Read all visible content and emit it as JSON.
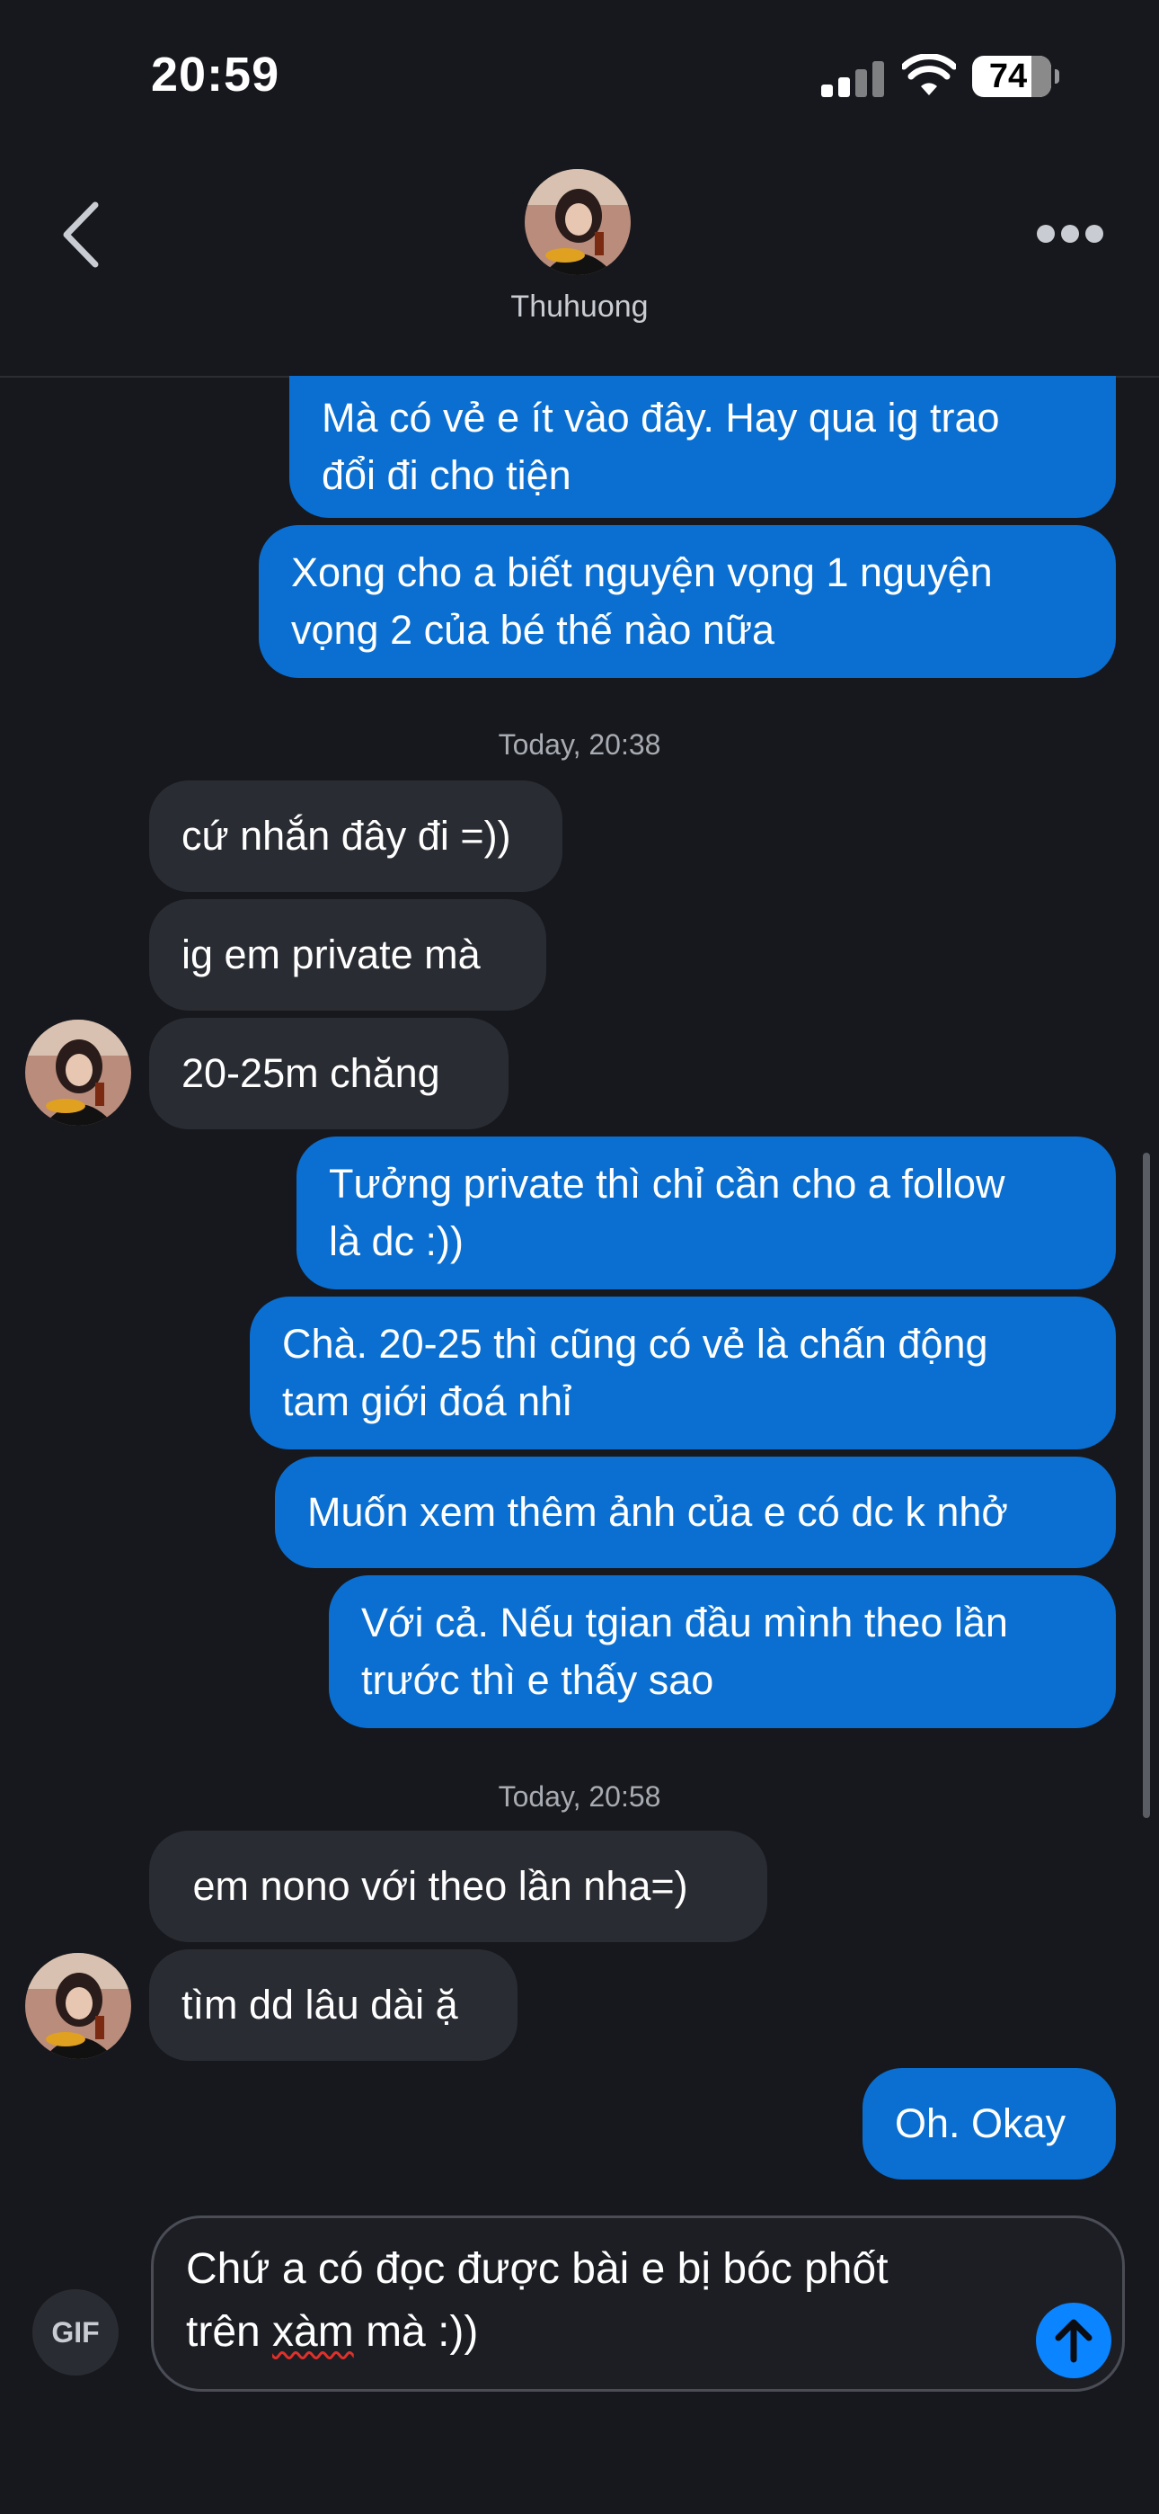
{
  "status_bar": {
    "time": "20:59",
    "battery": "74"
  },
  "header": {
    "contact_name": "Thuhuong"
  },
  "messages": [
    {
      "text": "Mà có vẻ e ít vào đây. Hay qua ig trao\nđổi đi cho tiện"
    },
    {
      "text": "Xong cho a biết nguyện vọng 1 nguyện\nvọng 2 của bé thế nào nữa"
    },
    {
      "text": "Today, 20:38"
    },
    {
      "text": "cứ nhắn đây đi =))"
    },
    {
      "text": "ig em private mà"
    },
    {
      "text": "20-25m chăng"
    },
    {
      "text": "Tưởng private thì chỉ cần cho a follow\nlà dc :))"
    },
    {
      "text": "Chà. 20-25 thì cũng có vẻ là chấn động\ntam giới đoá nhỉ"
    },
    {
      "text": "Muốn xem thêm ảnh của e có dc k nhở"
    },
    {
      "text": "Với cả. Nếu tgian đầu mình theo lần\ntrước thì e thấy sao"
    },
    {
      "text": "Today, 20:58"
    },
    {
      "text": " em nono với theo lần nha=)"
    },
    {
      "text": "tìm dd lâu dài ặ"
    },
    {
      "text": "Oh. Okay"
    }
  ],
  "composer": {
    "gif_label": "GIF",
    "line1": "Chứ a có đọc được bài e bị bóc phốt",
    "line2_prefix": "trên ",
    "line2_misspelled": "xàm",
    "line2_suffix": " mà :))"
  }
}
